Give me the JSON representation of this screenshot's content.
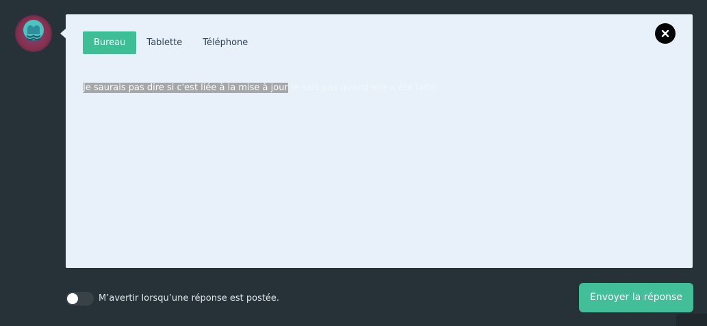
{
  "tabs": [
    {
      "label": "Bureau",
      "active": true
    },
    {
      "label": "Tablette",
      "active": false
    },
    {
      "label": "Téléphone",
      "active": false
    }
  ],
  "editor": {
    "selected_text": "Je saurais pas dire si c'est liée à la mise à jour",
    "rest_text": " Je sais pas quand elle a été faite ..."
  },
  "notify": {
    "label": "M’avertir lorsqu’une réponse est postée.",
    "enabled": false
  },
  "send_button": {
    "label": "Envoyer la réponse"
  },
  "colors": {
    "background": "#273238",
    "panel": "#e8f1fa",
    "accent": "#3dbe95",
    "close": "#050505"
  },
  "icons": {
    "avatar": "avatar-image",
    "close": "close-icon"
  }
}
